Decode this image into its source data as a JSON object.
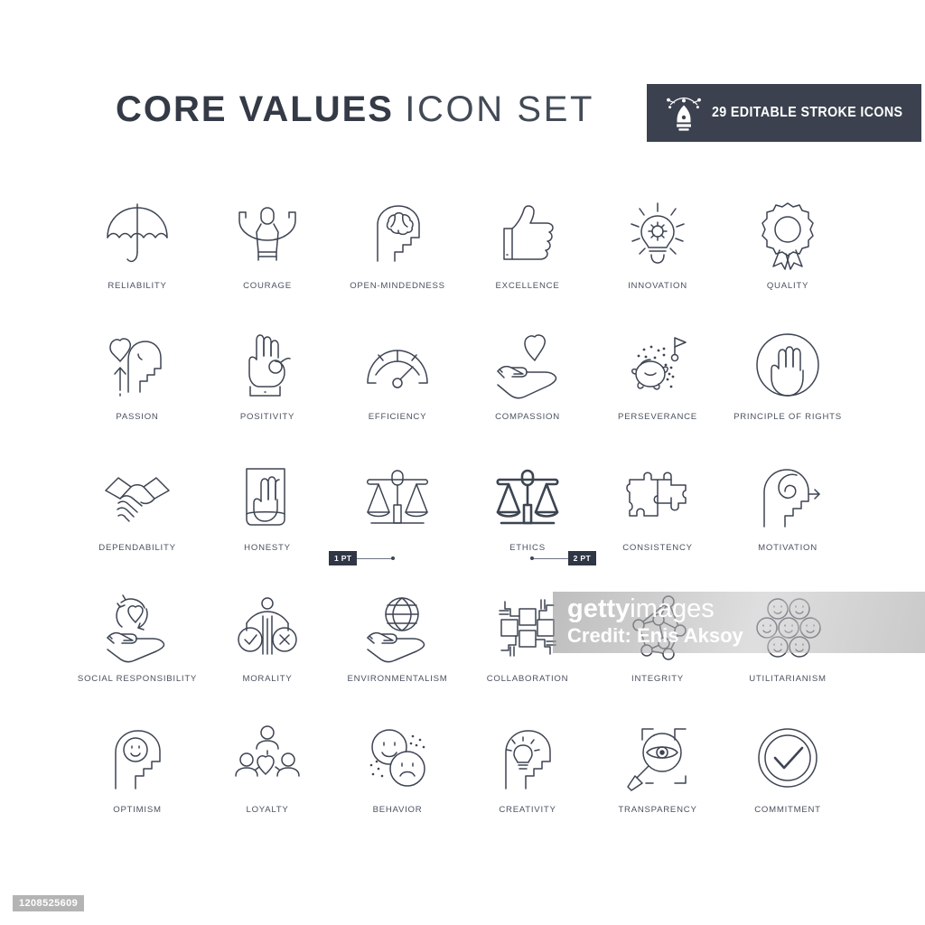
{
  "header": {
    "title_bold": "CORE VALUES",
    "title_light": "ICON SET",
    "badge_text": "29 EDITABLE STROKE ICONS",
    "badge_icon": "pen-nib-bezier-icon",
    "badge_bg": "#3b414f",
    "title_color": "#343a46"
  },
  "stroke_markers": {
    "one_pt": "1 PT",
    "two_pt": "2 PT"
  },
  "watermark": {
    "brand_bold": "getty",
    "brand_light": "images",
    "credit": "Credit: Enis Aksoy",
    "asset_id": "1208525609"
  },
  "grid": {
    "columns": 6,
    "rows": [
      [
        {
          "label": "RELIABILITY",
          "icon": "umbrella-icon"
        },
        {
          "label": "COURAGE",
          "icon": "person-arms-raised-icon"
        },
        {
          "label": "OPEN-MINDEDNESS",
          "icon": "head-brain-icon"
        },
        {
          "label": "EXCELLENCE",
          "icon": "thumbs-up-icon"
        },
        {
          "label": "INNOVATION",
          "icon": "lightbulb-rays-icon"
        },
        {
          "label": "QUALITY",
          "icon": "award-rosette-icon"
        }
      ],
      [
        {
          "label": "PASSION",
          "icon": "head-heart-arrow-icon"
        },
        {
          "label": "POSITIVITY",
          "icon": "ok-hand-icon"
        },
        {
          "label": "EFFICIENCY",
          "icon": "gauge-icon"
        },
        {
          "label": "COMPASSION",
          "icon": "hand-heart-icon"
        },
        {
          "label": "PERSEVERANCE",
          "icon": "turtle-flag-icon"
        },
        {
          "label": "PRINCIPLE OF RIGHTS",
          "icon": "raised-hand-circle-icon"
        }
      ],
      [
        {
          "label": "DEPENDABILITY",
          "icon": "handshake-icon"
        },
        {
          "label": "HONESTY",
          "icon": "hand-on-book-icon"
        },
        {
          "label": "",
          "icon": "balance-scales-thin-icon",
          "marker": "1 PT"
        },
        {
          "label": "ETHICS",
          "icon": "balance-scales-bold-icon",
          "marker": "2 PT"
        },
        {
          "label": "CONSISTENCY",
          "icon": "puzzle-pieces-icon"
        },
        {
          "label": "MOTIVATION",
          "icon": "head-spiral-arrow-icon"
        }
      ],
      [
        {
          "label": "SOCIAL RESPONSIBILITY",
          "icon": "hand-heart-recycle-icon"
        },
        {
          "label": "MORALITY",
          "icon": "figure-check-cross-icon"
        },
        {
          "label": "ENVIRONMENTALISM",
          "icon": "hand-globe-icon"
        },
        {
          "label": "COLLABORATION",
          "icon": "interlocking-hands-icon"
        },
        {
          "label": "INTEGRITY",
          "icon": "network-nodes-icon"
        },
        {
          "label": "UTILITARIANISM",
          "icon": "seven-smileys-icon"
        }
      ],
      [
        {
          "label": "OPTIMISM",
          "icon": "head-smiley-icon"
        },
        {
          "label": "LOYALTY",
          "icon": "three-people-heart-icon"
        },
        {
          "label": "BEHAVIOR",
          "icon": "happy-sad-faces-icon"
        },
        {
          "label": "CREATIVITY",
          "icon": "head-lightbulb-icon"
        },
        {
          "label": "TRANSPARENCY",
          "icon": "magnifier-eye-icon"
        },
        {
          "label": "COMMITMENT",
          "icon": "check-double-circle-icon"
        }
      ]
    ]
  }
}
